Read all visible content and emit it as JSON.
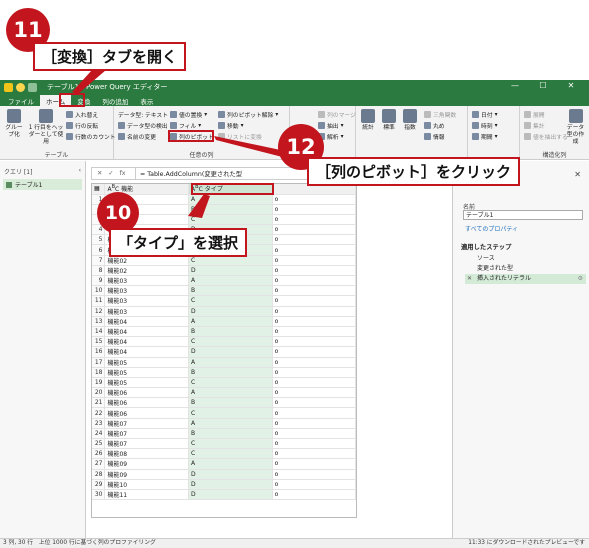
{
  "window": {
    "title": "テーブル1 - Power Query エディター",
    "controls": [
      "—",
      "☐",
      "✕"
    ]
  },
  "tabs": [
    "ファイル",
    "ホーム",
    "変換",
    "列の追加",
    "表示"
  ],
  "ribbon": {
    "group_table": {
      "label": "テーブル",
      "group_by": "グループ化",
      "header": "1 行目をヘッダーとして使用",
      "transpose": "入れ替え",
      "reverse": "行の反転",
      "count": "行数のカウント"
    },
    "group_anycol": {
      "label": "任意の列",
      "datatype": "データ型: テキスト",
      "detect": "データ型の検出",
      "rename": "名前の変更",
      "replace": "値の置換",
      "fill": "フィル",
      "pivot": "列のピボット",
      "unpivot": "列のピボット解除",
      "move": "移動",
      "tolist": "リストに変換"
    },
    "group_text": {
      "split": "列の分割",
      "format": "書式",
      "merge": "列のマージ",
      "extract": "抽出",
      "parse": "解析"
    },
    "group_number": {
      "stats": "統計",
      "standard": "標準",
      "scientific": "指数",
      "trig": "三角関数",
      "rounding": "丸め",
      "info": "情報"
    },
    "group_datetime": {
      "date": "日付",
      "time": "時刻",
      "duration": "期間"
    },
    "group_structured": {
      "label": "構造化列",
      "expand": "展開",
      "aggregate": "集計",
      "extract_values": "値を抽出する",
      "more": "データ型の作成"
    }
  },
  "query_pane": {
    "header": "クエリ [1]",
    "items": [
      "テーブル1"
    ]
  },
  "formula_bar": {
    "formula": "= Table.AddColumn(変更された型"
  },
  "grid": {
    "columns": [
      "機能",
      "タイプ",
      ""
    ],
    "rows": [
      [
        "1",
        "機能01",
        "A",
        "o"
      ],
      [
        "2",
        "機能01",
        "B",
        "o"
      ],
      [
        "3",
        "機能01",
        "C",
        "o"
      ],
      [
        "4",
        "機能01",
        "D",
        "o"
      ],
      [
        "5",
        "機能02",
        "A",
        "o"
      ],
      [
        "6",
        "機能02",
        "B",
        "o"
      ],
      [
        "7",
        "機能02",
        "C",
        "o"
      ],
      [
        "8",
        "機能02",
        "D",
        "o"
      ],
      [
        "9",
        "機能03",
        "A",
        "o"
      ],
      [
        "10",
        "機能03",
        "B",
        "o"
      ],
      [
        "11",
        "機能03",
        "C",
        "o"
      ],
      [
        "12",
        "機能03",
        "D",
        "o"
      ],
      [
        "13",
        "機能04",
        "A",
        "o"
      ],
      [
        "14",
        "機能04",
        "B",
        "o"
      ],
      [
        "15",
        "機能04",
        "C",
        "o"
      ],
      [
        "16",
        "機能04",
        "D",
        "o"
      ],
      [
        "17",
        "機能05",
        "A",
        "o"
      ],
      [
        "18",
        "機能05",
        "B",
        "o"
      ],
      [
        "19",
        "機能05",
        "C",
        "o"
      ],
      [
        "20",
        "機能06",
        "A",
        "o"
      ],
      [
        "21",
        "機能06",
        "B",
        "o"
      ],
      [
        "22",
        "機能06",
        "C",
        "o"
      ],
      [
        "23",
        "機能07",
        "A",
        "o"
      ],
      [
        "24",
        "機能07",
        "B",
        "o"
      ],
      [
        "25",
        "機能07",
        "C",
        "o"
      ],
      [
        "26",
        "機能08",
        "C",
        "o"
      ],
      [
        "27",
        "機能09",
        "A",
        "o"
      ],
      [
        "28",
        "機能09",
        "D",
        "o"
      ],
      [
        "29",
        "機能10",
        "D",
        "o"
      ],
      [
        "30",
        "機能11",
        "D",
        "o"
      ]
    ]
  },
  "settings_pane": {
    "name_label": "名前",
    "name_value": "テーブル1",
    "all_props": "すべてのプロパティ",
    "steps_label": "適用したステップ",
    "steps": [
      "ソース",
      "変更された型",
      "挿入されたリテラル"
    ]
  },
  "status": {
    "left": "3 列, 30 行　上位 1000 行に基づく列のプロファイリング",
    "right": "11:33 にダウンロードされたプレビューです"
  },
  "callouts": {
    "c11": "11",
    "c11_text": "［変換］タブを開く",
    "c12": "12",
    "c12_text": "［列のピボット］をクリック",
    "c10": "10",
    "c10_text": "「タイプ」を選択",
    "accent": "#c2151d"
  }
}
